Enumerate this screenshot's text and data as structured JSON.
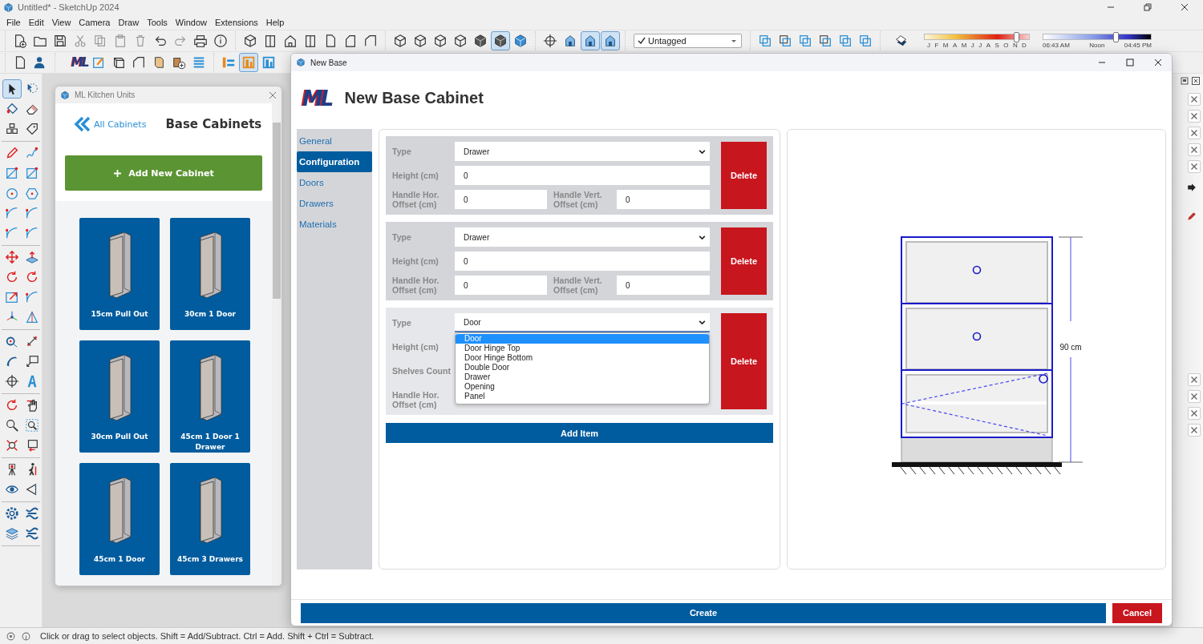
{
  "window": {
    "title": "Untitled* - SketchUp 2024"
  },
  "menu": [
    "File",
    "Edit",
    "View",
    "Camera",
    "Draw",
    "Tools",
    "Window",
    "Extensions",
    "Help"
  ],
  "toolbar_1": {
    "groups": [
      [
        {
          "selected": false
        },
        {
          "selected": false
        },
        {
          "selected": false
        },
        {
          "selected": false
        },
        {
          "selected": false
        },
        {
          "selected": false
        },
        {
          "selected": false
        },
        {
          "selected": false
        },
        {
          "selected": false
        },
        {
          "selected": false
        },
        {
          "selected": false
        }
      ],
      [
        {
          "selected": false
        },
        {
          "selected": false
        },
        {
          "selected": false
        },
        {
          "selected": false
        },
        {
          "selected": false
        },
        {
          "selected": false
        },
        {
          "selected": false
        }
      ],
      [
        {
          "selected": false
        },
        {
          "selected": false
        },
        {
          "selected": false
        },
        {
          "selected": false
        },
        {
          "selected": false
        },
        {
          "selected": true
        },
        {
          "selected": false
        }
      ],
      [
        {
          "selected": false
        },
        {
          "selected": false
        },
        {
          "selected": true
        },
        {
          "selected": true
        }
      ]
    ],
    "tag_select": {
      "value": "Untagged"
    },
    "tag_tools": [
      {
        "selected": false
      },
      {
        "selected": false
      },
      {
        "selected": false
      },
      {
        "selected": false
      },
      {
        "selected": false
      },
      {
        "selected": false
      }
    ],
    "shadow": {
      "month_slider": {
        "level": 0.88,
        "labels": [
          "J",
          "F",
          "M",
          "A",
          "M",
          "J",
          "J",
          "A",
          "S",
          "O",
          "N",
          "D"
        ]
      },
      "time_slider": {
        "level": 0.67,
        "labels": [
          "06:43 AM",
          "Noon",
          "04:45 PM"
        ]
      }
    }
  },
  "toolbar_2": {
    "file_tools": [
      {
        "selected": false
      },
      {
        "selected": false
      }
    ],
    "logo": "ML",
    "extension_tools": [
      {
        "selected": false
      },
      {
        "selected": false
      },
      {
        "selected": false
      },
      {
        "selected": false
      },
      {
        "selected": false
      },
      {
        "selected": false
      }
    ],
    "layout_tools": [
      {
        "selected": false
      },
      {
        "selected": true
      },
      {
        "selected": false
      }
    ]
  },
  "tool_palette": [
    {
      "selected": true
    },
    {
      "selected": false
    },
    {
      "selected": false
    },
    {
      "selected": false
    },
    {
      "selected": false
    },
    {
      "selected": false
    },
    {
      "selected": false
    },
    {
      "selected": false
    },
    {
      "selected": false
    },
    {
      "selected": false
    },
    {
      "selected": false
    },
    {
      "selected": false
    },
    {
      "selected": false
    },
    {
      "selected": false
    },
    {
      "selected": false
    },
    {
      "selected": false
    },
    {
      "selected": false
    },
    {
      "selected": false
    },
    {
      "selected": false
    },
    {
      "selected": false
    },
    {
      "selected": false
    },
    {
      "selected": false
    },
    {
      "selected": false
    },
    {
      "selected": false
    },
    {
      "selected": false
    },
    {
      "selected": false
    },
    {
      "selected": false
    },
    {
      "selected": false
    },
    {
      "selected": false
    },
    {
      "selected": false
    },
    {
      "selected": false
    },
    {
      "selected": false
    },
    {
      "selected": false
    },
    {
      "selected": false
    },
    {
      "selected": false
    },
    {
      "selected": false
    },
    {
      "selected": false
    },
    {
      "selected": false
    },
    {
      "selected": false
    },
    {
      "selected": false
    },
    {
      "selected": false
    },
    {
      "selected": false
    },
    {
      "selected": false
    },
    {
      "selected": false
    }
  ],
  "kitchen_panel": {
    "title": "ML Kitchen Units",
    "back_link": "All Cabinets",
    "heading": "Base Cabinets",
    "add_button": "Add New Cabinet",
    "cabinets": [
      {
        "label": "15cm Pull Out"
      },
      {
        "label": "30cm 1 Door"
      },
      {
        "label": "30cm Pull Out"
      },
      {
        "label": "45cm 1 Door 1 Drawer"
      },
      {
        "label": "45cm 1 Door"
      },
      {
        "label": "45cm 3 Drawers"
      }
    ]
  },
  "dialog": {
    "title": "New Base",
    "logo": "ML",
    "heading": "New Base Cabinet",
    "nav": [
      {
        "label": "General",
        "selected": false
      },
      {
        "label": "Configuration",
        "selected": true
      },
      {
        "label": "Doors",
        "selected": false
      },
      {
        "label": "Drawers",
        "selected": false
      },
      {
        "label": "Materials",
        "selected": false
      }
    ],
    "items": [
      {
        "type": {
          "label": "Type",
          "value": "Drawer",
          "expanded": false
        },
        "height": {
          "label": "Height (cm)",
          "value": "0"
        },
        "handle_hor": {
          "label": "Handle Hor. Offset (cm)",
          "value": "0"
        },
        "handle_vert": {
          "label": "Handle Vert. Offset (cm)",
          "value": "0"
        },
        "delete": "Delete"
      },
      {
        "type": {
          "label": "Type",
          "value": "Drawer",
          "expanded": false
        },
        "height": {
          "label": "Height (cm)",
          "value": "0"
        },
        "handle_hor": {
          "label": "Handle Hor. Offset (cm)",
          "value": "0"
        },
        "handle_vert": {
          "label": "Handle Vert. Offset (cm)",
          "value": "0"
        },
        "delete": "Delete"
      },
      {
        "type": {
          "label": "Type",
          "value": "Door",
          "expanded": true,
          "options": [
            {
              "label": "Door",
              "selected": true
            },
            {
              "label": "Door Hinge Top",
              "selected": false
            },
            {
              "label": "Door Hinge Bottom",
              "selected": false
            },
            {
              "label": "Double Door",
              "selected": false
            },
            {
              "label": "Drawer",
              "selected": false
            },
            {
              "label": "Opening",
              "selected": false
            },
            {
              "label": "Panel",
              "selected": false
            }
          ]
        },
        "height": {
          "label": "Height (cm)"
        },
        "shelves": {
          "label": "Shelves Count"
        },
        "handle_hor": {
          "label": "Handle Hor. Offset (cm)"
        },
        "delete": "Delete"
      }
    ],
    "add_item": "Add Item",
    "preview": {
      "dimension": "90 cm"
    },
    "create": "Create",
    "cancel": "Cancel"
  },
  "status_bar": {
    "text": "Click or drag to select objects. Shift = Add/Subtract. Ctrl = Add. Shift + Ctrl = Subtract."
  }
}
